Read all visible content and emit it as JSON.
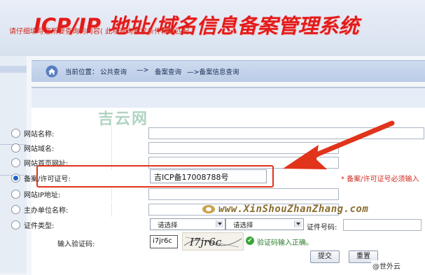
{
  "header": {
    "title": "ICP/IP 地址/域名信息备案管理系统"
  },
  "breadcrumb": {
    "prefix": "当前位置：",
    "items": [
      "公共查询",
      "—>",
      "备案查询",
      "—>备案信息查询"
    ]
  },
  "form": {
    "hint": "请仔细填写您所要查询的内容( 此项查询要求条件精确匹配 )",
    "rows": [
      {
        "label": "网站名称:",
        "checked": false
      },
      {
        "label": "网站域名:",
        "checked": false
      },
      {
        "label": "网站首页网址:",
        "checked": false
      },
      {
        "label": "备案/许可证号:",
        "checked": true
      },
      {
        "label": "网站IP地址:",
        "checked": false
      },
      {
        "label": "主办单位名称:",
        "checked": false
      },
      {
        "label": "证件类型:",
        "checked": false
      }
    ],
    "icp_value": "吉ICP备17008788号",
    "icp_required": "* 备案/许可证号必须输入",
    "select_1": "请选择",
    "select_2": "请选择",
    "cert_no_label": "证件号码:",
    "captcha_label": "输入验证码:",
    "captcha_value": "i7jr6c",
    "captcha_image_text": "I7jr6c",
    "captcha_ok": "验证码输入正确。",
    "submit_label": "提交",
    "reset_label": "重置"
  },
  "watermarks": {
    "site_logo": "吉云网",
    "url": "www.XinShouZhanZhang.com",
    "social": "@世外云"
  },
  "colors": {
    "accent_red": "#e21b1b",
    "nav_blue": "#1f5fc8",
    "arrow": "#e0341b"
  }
}
